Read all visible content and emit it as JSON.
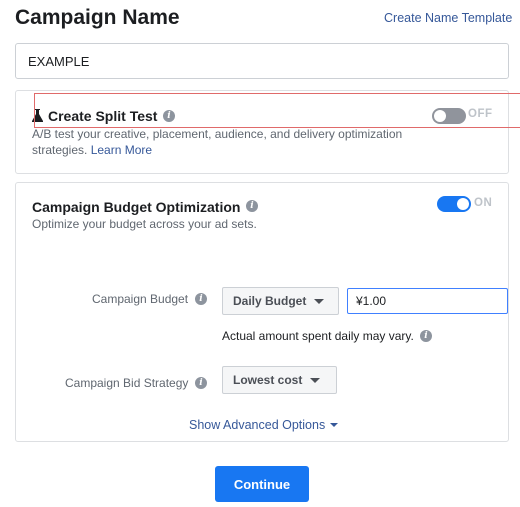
{
  "header": {
    "title": "Campaign Name",
    "create_template_link": "Create Name Template"
  },
  "campaign_name_input": {
    "value": "EXAMPLE"
  },
  "split_test": {
    "title": "Create Split Test",
    "description": "A/B test your creative, placement, audience, and delivery optimization strategies.",
    "learn_more": "Learn More",
    "toggle_state": "OFF"
  },
  "budget_optimization": {
    "title": "Campaign Budget Optimization",
    "description": "Optimize your budget across your ad sets.",
    "toggle_state": "ON",
    "campaign_budget_label": "Campaign Budget",
    "budget_type": "Daily Budget",
    "budget_amount": "¥1.00",
    "note": "Actual amount spent daily may vary.",
    "bid_strategy_label": "Campaign Bid Strategy",
    "bid_strategy": "Lowest cost",
    "advanced_options": "Show Advanced Options"
  },
  "footer": {
    "continue_label": "Continue"
  },
  "colors": {
    "accent": "#1877f2",
    "link": "#365899",
    "toggle_off": "#90949c",
    "highlight_box": "#e06a6a"
  },
  "icons": [
    "flask-icon",
    "info-icon",
    "caret-down-icon"
  ]
}
